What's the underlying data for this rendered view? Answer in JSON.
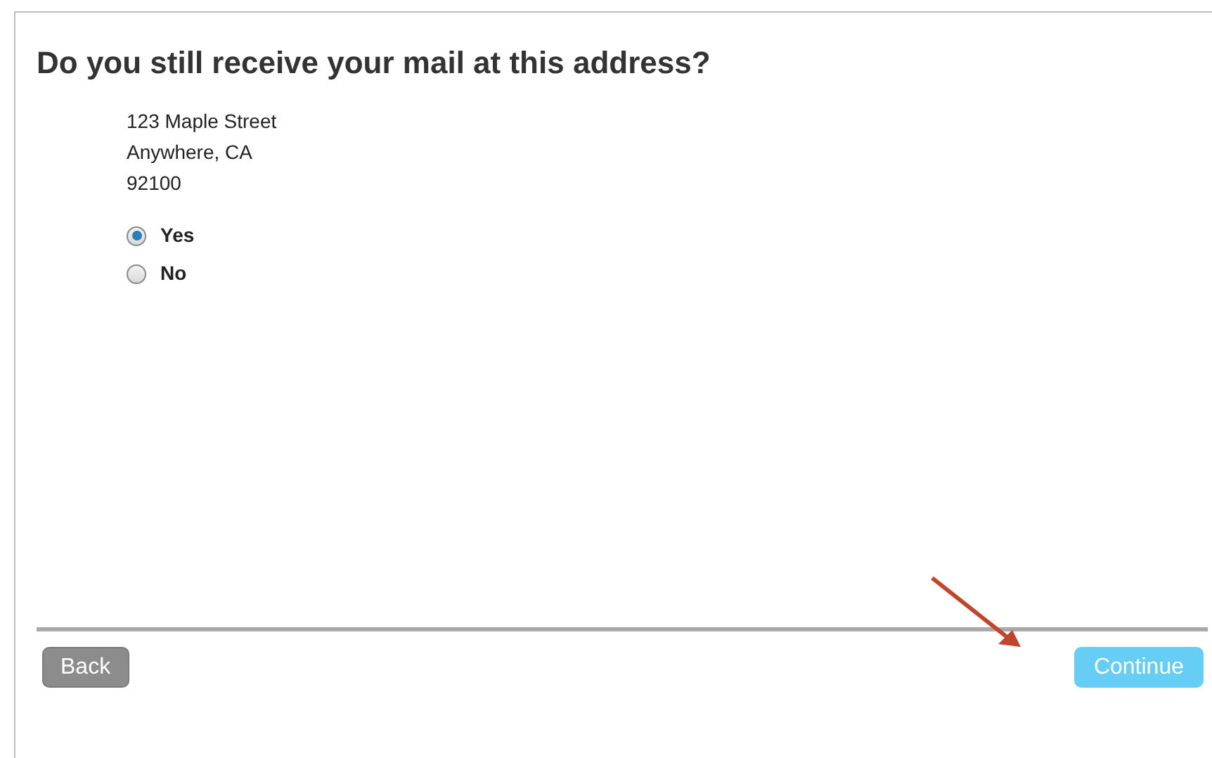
{
  "title": "Do you still receive your mail at this address?",
  "address": [
    "123 Maple Street",
    "Anywhere, CA",
    "92100"
  ],
  "options": [
    {
      "label": "Yes",
      "selected": true
    },
    {
      "label": "No",
      "selected": false
    }
  ],
  "buttons": {
    "back": "Back",
    "continue": "Continue"
  }
}
